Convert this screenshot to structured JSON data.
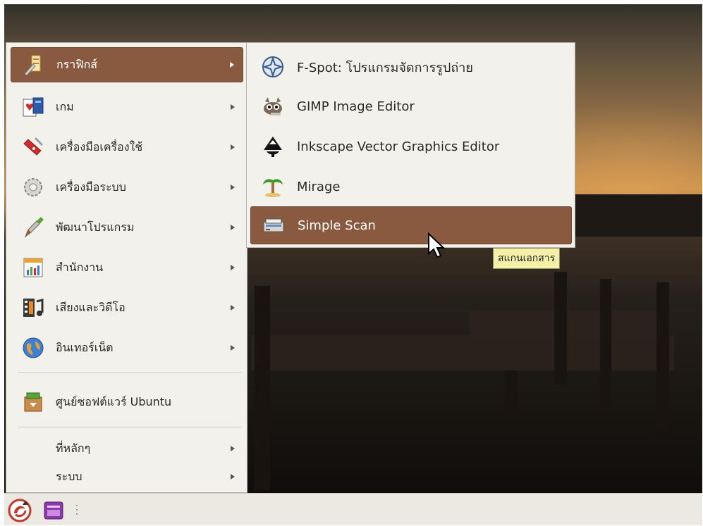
{
  "main_menu": {
    "items": [
      {
        "label": "กราฟิกส์",
        "icon": "graphics-icon",
        "has_submenu": true,
        "selected": true
      },
      {
        "label": "เกม",
        "icon": "games-icon",
        "has_submenu": true
      },
      {
        "label": "เครื่องมือเครื่องใช้",
        "icon": "accessories-icon",
        "has_submenu": true
      },
      {
        "label": "เครื่องมือระบบ",
        "icon": "system-tools-icon",
        "has_submenu": true
      },
      {
        "label": "พัฒนาโปรแกรม",
        "icon": "programming-icon",
        "has_submenu": true
      },
      {
        "label": "สำนักงาน",
        "icon": "office-icon",
        "has_submenu": true
      },
      {
        "label": "เสียงและวิดีโอ",
        "icon": "sound-video-icon",
        "has_submenu": true
      },
      {
        "label": "อินเทอร์เน็ต",
        "icon": "internet-icon",
        "has_submenu": true
      },
      {
        "label": "ศูนย์ซอฟต์แวร์ Ubuntu",
        "icon": "software-center-icon",
        "has_submenu": false
      },
      {
        "label": "ที่หลักๆ",
        "has_submenu": true
      },
      {
        "label": "ระบบ",
        "has_submenu": true
      }
    ]
  },
  "submenu": {
    "items": [
      {
        "label": "F-Spot: โปรแกรมจัดการรูปถ่าย",
        "icon": "f-spot-icon"
      },
      {
        "label": "GIMP Image Editor",
        "icon": "gimp-icon"
      },
      {
        "label": "Inkscape Vector Graphics Editor",
        "icon": "inkscape-icon"
      },
      {
        "label": "Mirage",
        "icon": "mirage-icon"
      },
      {
        "label": "Simple Scan",
        "icon": "scanner-icon",
        "selected": true
      }
    ]
  },
  "tooltip": "สแกนเอกสาร",
  "colors": {
    "selection": "#8a5a40",
    "menu_bg": "#f3f1ec",
    "tooltip_bg": "#f5f0a8",
    "panel_bg": "#ece9e3"
  }
}
